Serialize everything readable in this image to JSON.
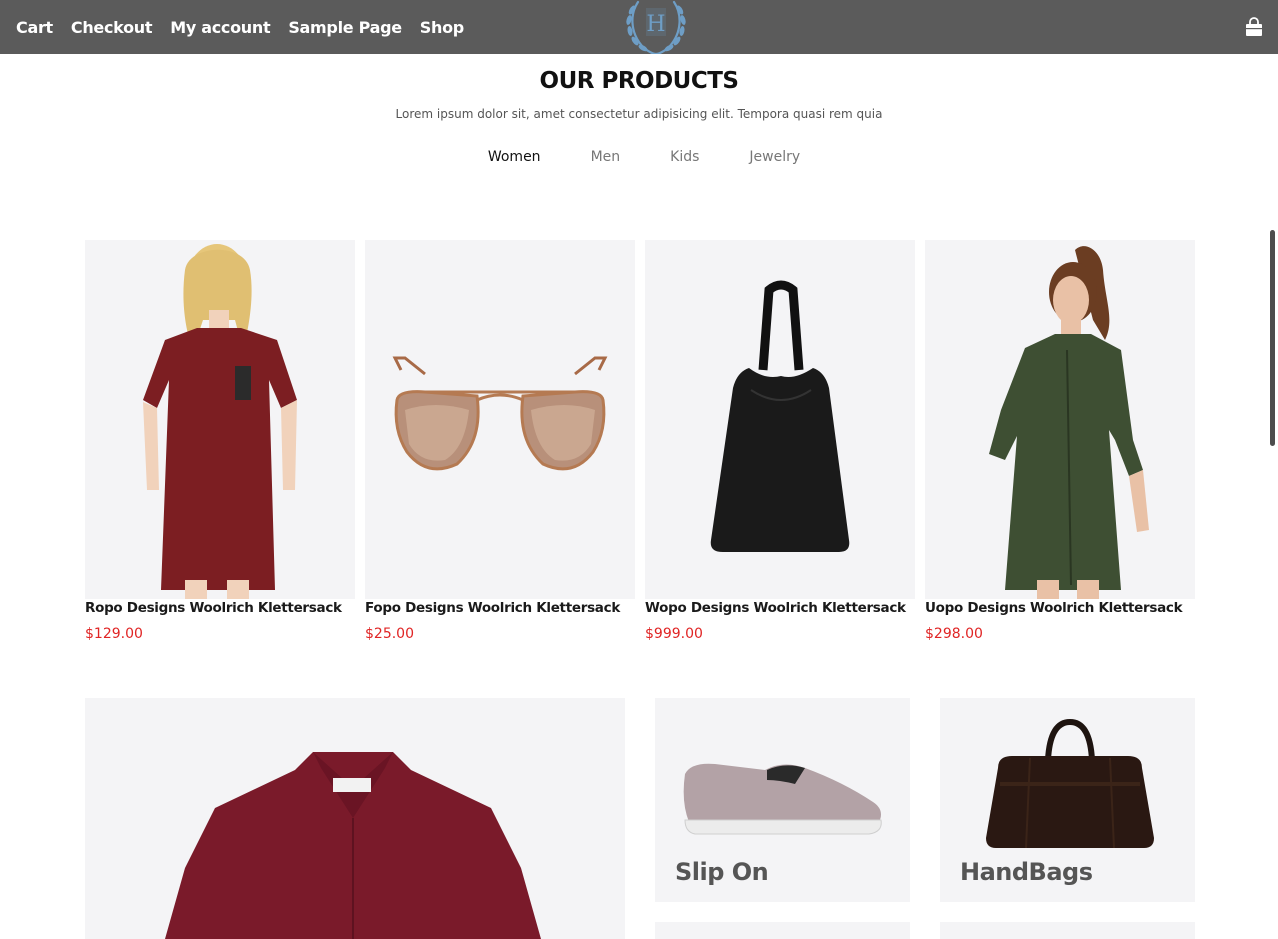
{
  "nav": {
    "items": [
      "Cart",
      "Checkout",
      "My account",
      "Sample Page",
      "Shop"
    ],
    "logo_letter": "H"
  },
  "section": {
    "title": "OUR PRODUCTS",
    "subtitle": "Lorem ipsum dolor sit, amet consectetur adipisicing elit. Tempora quasi rem quia"
  },
  "tabs": [
    {
      "label": "Women",
      "active": true
    },
    {
      "label": "Men",
      "active": false
    },
    {
      "label": "Kids",
      "active": false
    },
    {
      "label": "Jewelry",
      "active": false
    }
  ],
  "products": [
    {
      "name": "Ropo Designs Woolrich Klettersack",
      "price": "$129.00",
      "image": "red-dress-model"
    },
    {
      "name": "Fopo Designs Woolrich Klettersack",
      "price": "$25.00",
      "image": "aviator-sunglasses"
    },
    {
      "name": "Wopo Designs Woolrich Klettersack",
      "price": "$999.00",
      "image": "black-tote-bag"
    },
    {
      "name": "Uopo Designs Woolrich Klettersack",
      "price": "$298.00",
      "image": "green-shirt-dress-model"
    }
  ],
  "promos": [
    {
      "label": "Slip On",
      "image": "slip-on-shoe"
    },
    {
      "label": "HandBags",
      "image": "leather-duffel-bag"
    }
  ],
  "colors": {
    "topbar": "#5b5b5b",
    "price": "#e02424",
    "card_bg": "#f4f4f6",
    "logo": "#6e9ec6"
  }
}
